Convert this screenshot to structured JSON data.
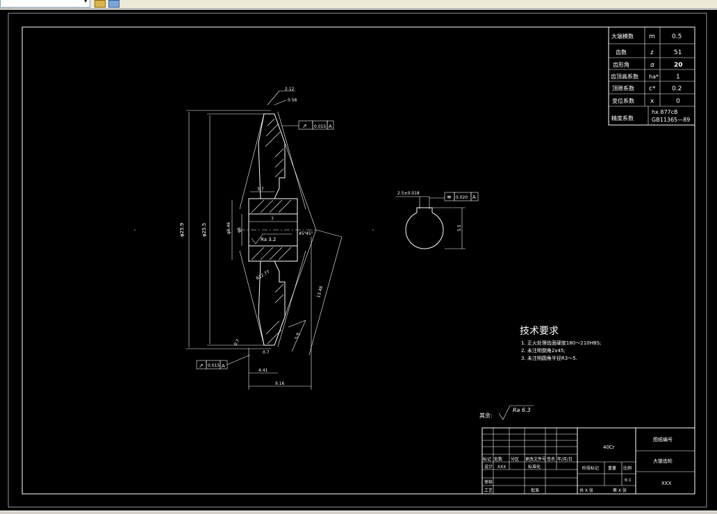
{
  "toolbar": {
    "combo_arrow": "▾",
    "icons": [
      "layer-icon",
      "layers-stack-icon"
    ]
  },
  "params": [
    {
      "name": "大端模数",
      "symbol": "m",
      "value": "0.5"
    },
    {
      "name": "齿数",
      "symbol": "z",
      "value": "51"
    },
    {
      "name": "齿形角",
      "symbol": "α",
      "value": "20"
    },
    {
      "name": "齿顶高系数",
      "symbol": "ha*",
      "value": "1"
    },
    {
      "name": "顶隙系数",
      "symbol": "c*",
      "value": "0.2"
    },
    {
      "name": "变位系数",
      "symbol": "x",
      "value": "0"
    },
    {
      "name": "精度系数",
      "symbol": "",
      "value": "hx 877cB",
      "value2": "GB11365—89"
    }
  ],
  "dims": {
    "d1": "2.12",
    "d2": "0.56",
    "tol_top": "0.015",
    "datum": "A",
    "w37": "3.7",
    "w7": "7",
    "d_hub": "φ8.46",
    "d_bore": "φ6",
    "rough_mid": "Ra 3.2",
    "d_outer1": "φ25.9",
    "d_outer2": "φ25.5",
    "ang1": "45°",
    "ang2": "45°",
    "len_cone": "13.48",
    "len5": "5.9",
    "r_cone": "R12.77",
    "d7": "0.7",
    "d_small": "0.7",
    "tol_bottom": "0.015",
    "w441": "4.41",
    "w916": "9.16"
  },
  "keyway": {
    "width_label": "2.5±0.018",
    "sym_tol": "0.020",
    "datum": "A",
    "depth": "5.5"
  },
  "tech_requirements": {
    "title": "技术要求",
    "items": [
      "1. 正火处理齿面硬度180～210HBS;",
      "2. 未注明倒角2x45;",
      "3. 未注明圆角半径R3～5."
    ]
  },
  "surface": {
    "label": "其余:",
    "ra": "Ra 6.3"
  },
  "title_block": {
    "material": "40Cr",
    "drawing_no": "图纸编号",
    "part_name": "大锥齿轮",
    "designer_field": "XXX",
    "revision_headers": [
      "标记",
      "处数",
      "分区",
      "更改文件号",
      "签名",
      "年/月/日"
    ],
    "design": "设计",
    "design_name": "XXX",
    "standardize": "标准化",
    "review": "审核",
    "process": "工艺",
    "approve": "批准",
    "stage": "阶段标记",
    "weight": "重量",
    "scale": "比例",
    "scale_value": "6:1",
    "sheets": "共 X 张",
    "sheet": "第 X 张",
    "company": "XXX"
  }
}
